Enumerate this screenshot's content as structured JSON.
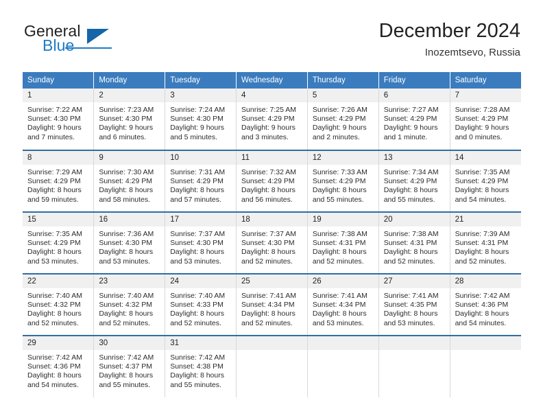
{
  "brand": {
    "word_one": "General",
    "word_two": "Blue",
    "triangle_icon": "triangle-icon",
    "accent_color": "#1d7cc4",
    "triangle_color": "#1565a8"
  },
  "header": {
    "title": "December 2024",
    "subtitle": "Inozemtsevo, Russia"
  },
  "calendar": {
    "header_bg": "#3a7cbe",
    "daynum_bg": "#f0f0f0",
    "row_divider_color": "#2e6da4",
    "weekdays": [
      "Sunday",
      "Monday",
      "Tuesday",
      "Wednesday",
      "Thursday",
      "Friday",
      "Saturday"
    ],
    "weeks": [
      [
        {
          "day": "1",
          "sunrise": "Sunrise: 7:22 AM",
          "sunset": "Sunset: 4:30 PM",
          "daylight_1": "Daylight: 9 hours",
          "daylight_2": "and 7 minutes."
        },
        {
          "day": "2",
          "sunrise": "Sunrise: 7:23 AM",
          "sunset": "Sunset: 4:30 PM",
          "daylight_1": "Daylight: 9 hours",
          "daylight_2": "and 6 minutes."
        },
        {
          "day": "3",
          "sunrise": "Sunrise: 7:24 AM",
          "sunset": "Sunset: 4:30 PM",
          "daylight_1": "Daylight: 9 hours",
          "daylight_2": "and 5 minutes."
        },
        {
          "day": "4",
          "sunrise": "Sunrise: 7:25 AM",
          "sunset": "Sunset: 4:29 PM",
          "daylight_1": "Daylight: 9 hours",
          "daylight_2": "and 3 minutes."
        },
        {
          "day": "5",
          "sunrise": "Sunrise: 7:26 AM",
          "sunset": "Sunset: 4:29 PM",
          "daylight_1": "Daylight: 9 hours",
          "daylight_2": "and 2 minutes."
        },
        {
          "day": "6",
          "sunrise": "Sunrise: 7:27 AM",
          "sunset": "Sunset: 4:29 PM",
          "daylight_1": "Daylight: 9 hours",
          "daylight_2": "and 1 minute."
        },
        {
          "day": "7",
          "sunrise": "Sunrise: 7:28 AM",
          "sunset": "Sunset: 4:29 PM",
          "daylight_1": "Daylight: 9 hours",
          "daylight_2": "and 0 minutes."
        }
      ],
      [
        {
          "day": "8",
          "sunrise": "Sunrise: 7:29 AM",
          "sunset": "Sunset: 4:29 PM",
          "daylight_1": "Daylight: 8 hours",
          "daylight_2": "and 59 minutes."
        },
        {
          "day": "9",
          "sunrise": "Sunrise: 7:30 AM",
          "sunset": "Sunset: 4:29 PM",
          "daylight_1": "Daylight: 8 hours",
          "daylight_2": "and 58 minutes."
        },
        {
          "day": "10",
          "sunrise": "Sunrise: 7:31 AM",
          "sunset": "Sunset: 4:29 PM",
          "daylight_1": "Daylight: 8 hours",
          "daylight_2": "and 57 minutes."
        },
        {
          "day": "11",
          "sunrise": "Sunrise: 7:32 AM",
          "sunset": "Sunset: 4:29 PM",
          "daylight_1": "Daylight: 8 hours",
          "daylight_2": "and 56 minutes."
        },
        {
          "day": "12",
          "sunrise": "Sunrise: 7:33 AM",
          "sunset": "Sunset: 4:29 PM",
          "daylight_1": "Daylight: 8 hours",
          "daylight_2": "and 55 minutes."
        },
        {
          "day": "13",
          "sunrise": "Sunrise: 7:34 AM",
          "sunset": "Sunset: 4:29 PM",
          "daylight_1": "Daylight: 8 hours",
          "daylight_2": "and 55 minutes."
        },
        {
          "day": "14",
          "sunrise": "Sunrise: 7:35 AM",
          "sunset": "Sunset: 4:29 PM",
          "daylight_1": "Daylight: 8 hours",
          "daylight_2": "and 54 minutes."
        }
      ],
      [
        {
          "day": "15",
          "sunrise": "Sunrise: 7:35 AM",
          "sunset": "Sunset: 4:29 PM",
          "daylight_1": "Daylight: 8 hours",
          "daylight_2": "and 53 minutes."
        },
        {
          "day": "16",
          "sunrise": "Sunrise: 7:36 AM",
          "sunset": "Sunset: 4:30 PM",
          "daylight_1": "Daylight: 8 hours",
          "daylight_2": "and 53 minutes."
        },
        {
          "day": "17",
          "sunrise": "Sunrise: 7:37 AM",
          "sunset": "Sunset: 4:30 PM",
          "daylight_1": "Daylight: 8 hours",
          "daylight_2": "and 53 minutes."
        },
        {
          "day": "18",
          "sunrise": "Sunrise: 7:37 AM",
          "sunset": "Sunset: 4:30 PM",
          "daylight_1": "Daylight: 8 hours",
          "daylight_2": "and 52 minutes."
        },
        {
          "day": "19",
          "sunrise": "Sunrise: 7:38 AM",
          "sunset": "Sunset: 4:31 PM",
          "daylight_1": "Daylight: 8 hours",
          "daylight_2": "and 52 minutes."
        },
        {
          "day": "20",
          "sunrise": "Sunrise: 7:38 AM",
          "sunset": "Sunset: 4:31 PM",
          "daylight_1": "Daylight: 8 hours",
          "daylight_2": "and 52 minutes."
        },
        {
          "day": "21",
          "sunrise": "Sunrise: 7:39 AM",
          "sunset": "Sunset: 4:31 PM",
          "daylight_1": "Daylight: 8 hours",
          "daylight_2": "and 52 minutes."
        }
      ],
      [
        {
          "day": "22",
          "sunrise": "Sunrise: 7:40 AM",
          "sunset": "Sunset: 4:32 PM",
          "daylight_1": "Daylight: 8 hours",
          "daylight_2": "and 52 minutes."
        },
        {
          "day": "23",
          "sunrise": "Sunrise: 7:40 AM",
          "sunset": "Sunset: 4:32 PM",
          "daylight_1": "Daylight: 8 hours",
          "daylight_2": "and 52 minutes."
        },
        {
          "day": "24",
          "sunrise": "Sunrise: 7:40 AM",
          "sunset": "Sunset: 4:33 PM",
          "daylight_1": "Daylight: 8 hours",
          "daylight_2": "and 52 minutes."
        },
        {
          "day": "25",
          "sunrise": "Sunrise: 7:41 AM",
          "sunset": "Sunset: 4:34 PM",
          "daylight_1": "Daylight: 8 hours",
          "daylight_2": "and 52 minutes."
        },
        {
          "day": "26",
          "sunrise": "Sunrise: 7:41 AM",
          "sunset": "Sunset: 4:34 PM",
          "daylight_1": "Daylight: 8 hours",
          "daylight_2": "and 53 minutes."
        },
        {
          "day": "27",
          "sunrise": "Sunrise: 7:41 AM",
          "sunset": "Sunset: 4:35 PM",
          "daylight_1": "Daylight: 8 hours",
          "daylight_2": "and 53 minutes."
        },
        {
          "day": "28",
          "sunrise": "Sunrise: 7:42 AM",
          "sunset": "Sunset: 4:36 PM",
          "daylight_1": "Daylight: 8 hours",
          "daylight_2": "and 54 minutes."
        }
      ],
      [
        {
          "day": "29",
          "sunrise": "Sunrise: 7:42 AM",
          "sunset": "Sunset: 4:36 PM",
          "daylight_1": "Daylight: 8 hours",
          "daylight_2": "and 54 minutes."
        },
        {
          "day": "30",
          "sunrise": "Sunrise: 7:42 AM",
          "sunset": "Sunset: 4:37 PM",
          "daylight_1": "Daylight: 8 hours",
          "daylight_2": "and 55 minutes."
        },
        {
          "day": "31",
          "sunrise": "Sunrise: 7:42 AM",
          "sunset": "Sunset: 4:38 PM",
          "daylight_1": "Daylight: 8 hours",
          "daylight_2": "and 55 minutes."
        },
        {
          "day": "",
          "sunrise": "",
          "sunset": "",
          "daylight_1": "",
          "daylight_2": ""
        },
        {
          "day": "",
          "sunrise": "",
          "sunset": "",
          "daylight_1": "",
          "daylight_2": ""
        },
        {
          "day": "",
          "sunrise": "",
          "sunset": "",
          "daylight_1": "",
          "daylight_2": ""
        },
        {
          "day": "",
          "sunrise": "",
          "sunset": "",
          "daylight_1": "",
          "daylight_2": ""
        }
      ]
    ]
  }
}
